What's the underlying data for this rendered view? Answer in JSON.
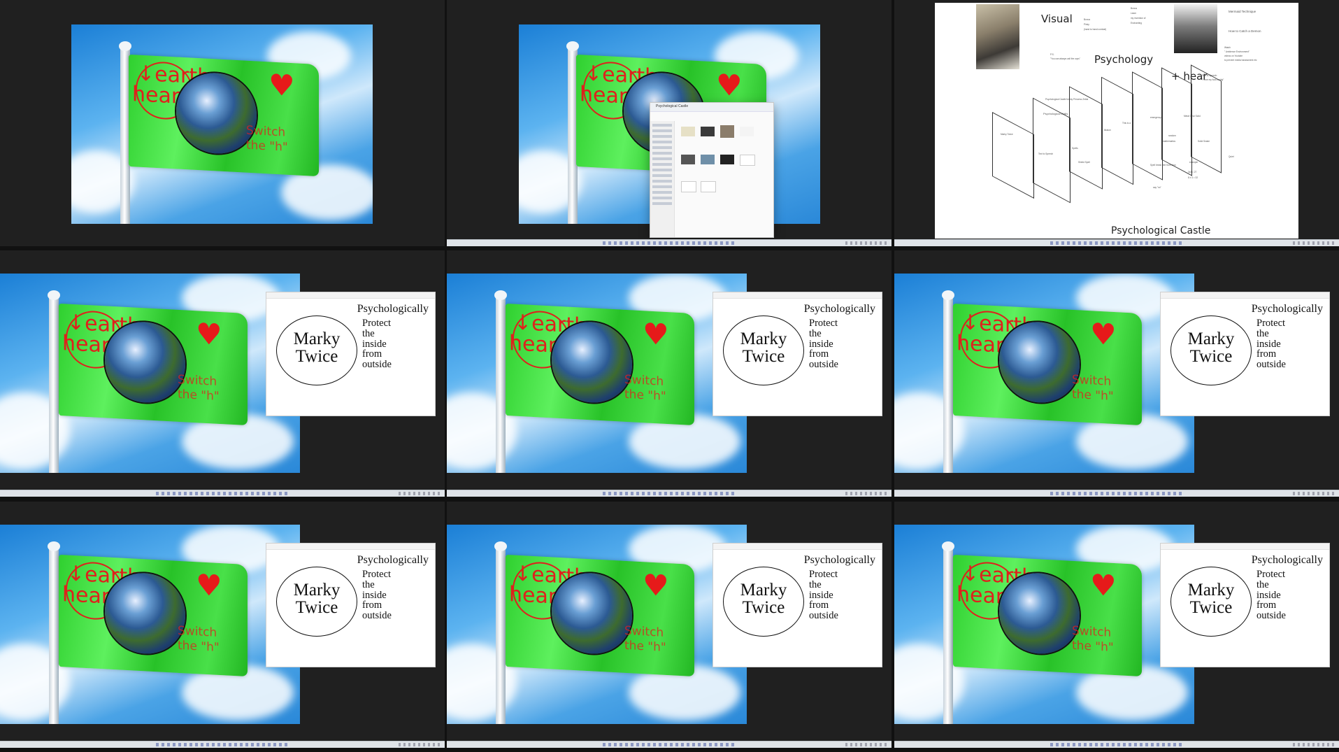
{
  "layout": "3x3 grid of desktop screenshots",
  "flag": {
    "word_top": "earth",
    "word_bottom": "heart",
    "arrow": "↓",
    "heart_symbol": "♥",
    "switch_line1": "Switch",
    "switch_line2": "the \"h\""
  },
  "doc_window": {
    "heading": "Psychologically",
    "oval_line1": "Marky",
    "oval_line2": "Twice",
    "lines": [
      "Protect",
      "the",
      "inside",
      "from",
      "outside"
    ]
  },
  "explorer": {
    "title": "Psychological Castle"
  },
  "notes": {
    "visual": "Visual",
    "psychology": "Psychology",
    "hear": "+ hear",
    "castle_title": "Psychological Castle",
    "mermaid": "Mermaid Technique",
    "demon": "How to Catch a Demon",
    "bonus": "Bonus",
    "pinky": "Pinky",
    "hand_combat": "(hand to hand combat)",
    "bonus_learn": "Learn",
    "my_invention": "my invention of",
    "enchanting": "Enchanting",
    "ps": "P.S.",
    "call_cops": "\"You can always call the cops\"",
    "watch": "Watch",
    "ambience": "\" Ambience Environment\"",
    "youtube": "videos on Youtube",
    "prevent": "to prevent media harassment etc",
    "tts": "Text to Speech:",
    "love_buddy": "\"I love my fuck buddy\"",
    "princess": "Psychological Castle for my Princess Zelda",
    "walls": "Psychological Walls",
    "marky_twice": "Marky Twice",
    "text_speech": "Text to Speech",
    "spells": "Spells",
    "shield_spell": "Shield Spell",
    "illusion": "illusion",
    "this_is_a": "This is a",
    "emergency": "emergency",
    "metal_gear": "Metal Gear Solid",
    "random": "random",
    "mathematics": "mathematics",
    "solid_snake": "Solid Snake",
    "example": "example",
    "math": "3x3 = 27",
    "math2": "8 x 4 = 32",
    "spell_break": "Spell break free from stun",
    "say_no": "say \"no\"",
    "quiet": "Quiet"
  },
  "taskbar": {
    "search_icon": "search-icon",
    "start_icon": "windows-start-icon"
  },
  "colors": {
    "flag_green": "#3fdc3f",
    "text_red": "#e0201c",
    "background": "#202020"
  }
}
